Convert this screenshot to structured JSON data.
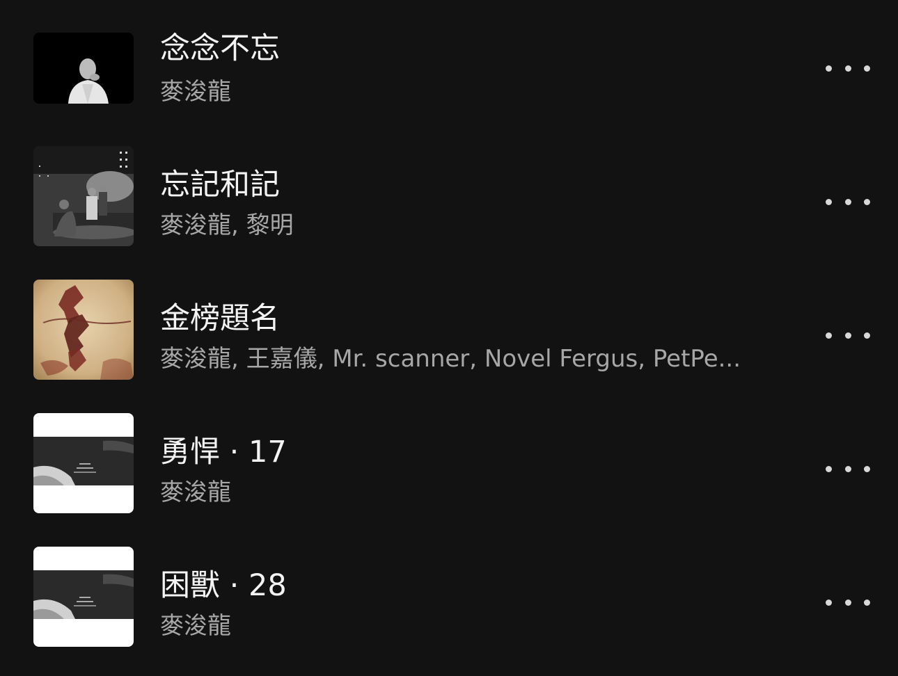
{
  "tracks": [
    {
      "title": "念念不忘",
      "artists": "麥浚龍",
      "artwork": "portrait-black-white"
    },
    {
      "title": "忘記和記",
      "artists": "麥浚龍, 黎明",
      "artwork": "film-still-dark"
    },
    {
      "title": "金榜題名",
      "artists": "麥浚龍, 王嘉儀, Mr. scanner, Novel Fergus, PetPe...",
      "artwork": "calligraphy-parchment"
    },
    {
      "title": "勇悍 · 17",
      "artists": "麥浚龍",
      "artwork": "album-banner-white"
    },
    {
      "title": "困獸 · 28",
      "artists": "麥浚龍",
      "artwork": "album-banner-white"
    }
  ],
  "colors": {
    "background": "#121212",
    "title": "#f4f4f4",
    "subtitle": "#a7a7a7",
    "more_dots": "#d8d8d8"
  },
  "icons": {
    "more": "more-horizontal-icon"
  }
}
